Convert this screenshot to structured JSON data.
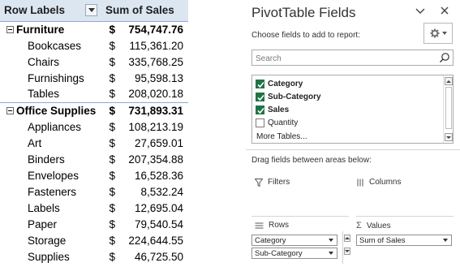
{
  "pivot": {
    "header": {
      "row_labels": "Row Labels",
      "sum_of_sales": "Sum of Sales"
    },
    "currency_symbol": "$",
    "rows": [
      {
        "type": "group",
        "label": "Furniture",
        "value": "754,747.76"
      },
      {
        "type": "item",
        "label": "Bookcases",
        "value": "115,361.20"
      },
      {
        "type": "item",
        "label": "Chairs",
        "value": "335,768.25"
      },
      {
        "type": "item",
        "label": "Furnishings",
        "value": "95,598.13"
      },
      {
        "type": "item",
        "label": "Tables",
        "value": "208,020.18"
      },
      {
        "type": "group",
        "label": "Office Supplies",
        "value": "731,893.31"
      },
      {
        "type": "item",
        "label": "Appliances",
        "value": "108,213.19"
      },
      {
        "type": "item",
        "label": "Art",
        "value": "27,659.01"
      },
      {
        "type": "item",
        "label": "Binders",
        "value": "207,354.88"
      },
      {
        "type": "item",
        "label": "Envelopes",
        "value": "16,528.36"
      },
      {
        "type": "item",
        "label": "Fasteners",
        "value": "8,532.24"
      },
      {
        "type": "item",
        "label": "Labels",
        "value": "12,695.04"
      },
      {
        "type": "item",
        "label": "Paper",
        "value": "79,540.54"
      },
      {
        "type": "item",
        "label": "Storage",
        "value": "224,644.55"
      },
      {
        "type": "item",
        "label": "Supplies",
        "value": "46,725.50"
      }
    ]
  },
  "fields_pane": {
    "title": "PivotTable Fields",
    "choose_label": "Choose fields to add to report:",
    "search_placeholder": "Search",
    "fields": [
      {
        "label": "Category",
        "checked": true
      },
      {
        "label": "Sub-Category",
        "checked": true
      },
      {
        "label": "Sales",
        "checked": true
      },
      {
        "label": "Quantity",
        "checked": false
      }
    ],
    "more_tables": "More Tables...",
    "drag_label": "Drag fields between areas below:",
    "areas": {
      "filters": {
        "title": "Filters"
      },
      "columns": {
        "title": "Columns"
      },
      "rows": {
        "title": "Rows",
        "items": [
          "Category",
          "Sub-Category"
        ]
      },
      "values": {
        "title": "Values",
        "items": [
          "Sum of Sales"
        ]
      }
    }
  },
  "colors": {
    "header_fill": "#dce6f1",
    "header_border": "#8ea9db",
    "checkbox_green": "#217346"
  },
  "icons": [
    "filter-dropdown-icon",
    "collapse-minus-icon",
    "chevron-down-icon",
    "close-icon",
    "gear-icon",
    "search-icon",
    "filter-area-icon",
    "columns-area-icon",
    "rows-area-icon",
    "sigma-icon"
  ]
}
